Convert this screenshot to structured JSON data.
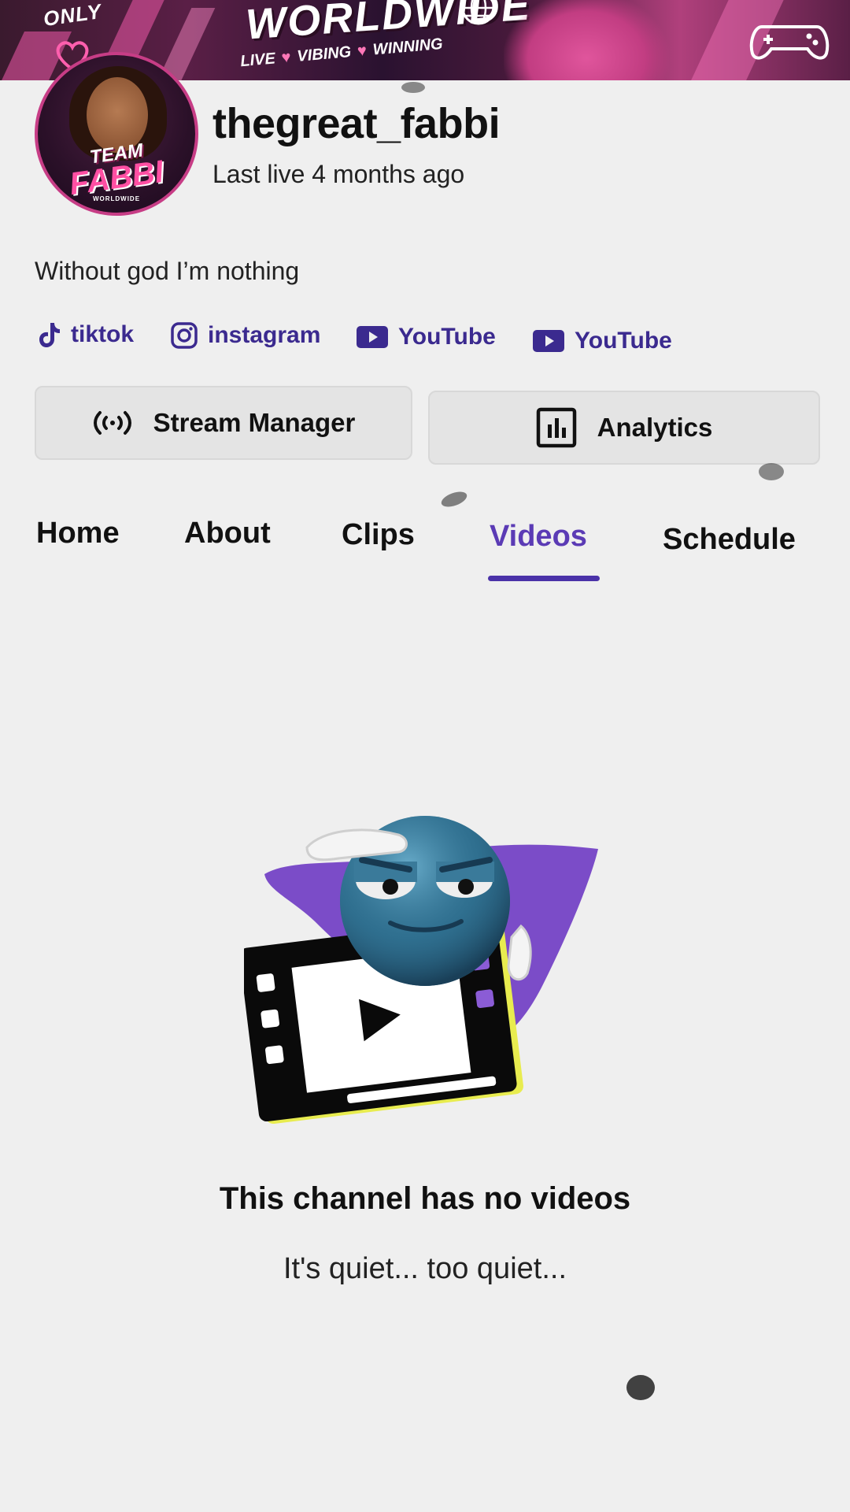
{
  "banner": {
    "top_left_text": "ONLY",
    "title": "WORLDWIDE",
    "tagline": [
      "LIVE",
      "VIBING",
      "WINNING"
    ]
  },
  "avatar": {
    "line1": "TEAM",
    "line2": "FABBI",
    "line3": "WORLDWIDE"
  },
  "profile": {
    "username": "thegreat_fabbi",
    "last_live": "Last live 4 months ago",
    "bio": "Without god I’m nothing"
  },
  "social_links": [
    {
      "label": "tiktok",
      "icon": "tiktok-icon"
    },
    {
      "label": "instagram",
      "icon": "instagram-icon"
    },
    {
      "label": "YouTube",
      "icon": "youtube-icon"
    },
    {
      "label": "YouTube",
      "icon": "youtube-icon"
    }
  ],
  "actions": {
    "stream_manager": {
      "label": "Stream Manager",
      "icon": "broadcast-icon"
    },
    "analytics": {
      "label": "Analytics",
      "icon": "bar-chart-icon"
    }
  },
  "tabs": [
    {
      "label": "Home",
      "active": false
    },
    {
      "label": "About",
      "active": false
    },
    {
      "label": "Clips",
      "active": false
    },
    {
      "label": "Videos",
      "active": true
    },
    {
      "label": "Schedule",
      "active": false
    }
  ],
  "empty_state": {
    "title": "This channel has no videos",
    "subtitle": "It's quiet... too quiet...",
    "icon": "saluting-emoji-film-icon"
  },
  "colors": {
    "accent": "#5b3bb5",
    "link": "#3b2a8f",
    "background": "#efefef",
    "banner_pink": "#c73d86"
  }
}
